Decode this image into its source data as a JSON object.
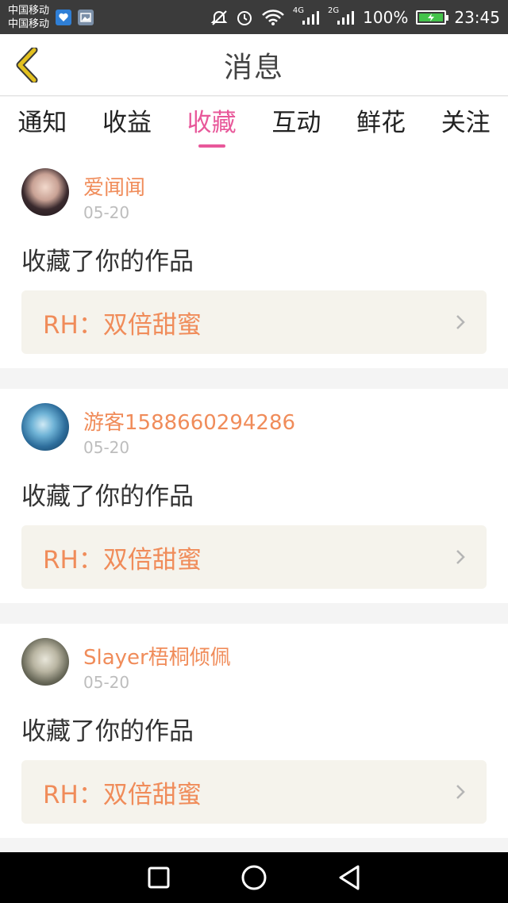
{
  "status_bar": {
    "carrier_1": "中国移动",
    "carrier_2": "中国移动",
    "battery_percent": "100%",
    "time": "23:45",
    "net_4g": "4G",
    "net_2g": "2G",
    "icons": [
      "mute-icon",
      "alarm-icon",
      "wifi-icon",
      "signal-icon",
      "battery-icon"
    ]
  },
  "header": {
    "title": "消息",
    "back_icon": "chevron-left-icon"
  },
  "tabs": [
    {
      "label": "通知",
      "active": false
    },
    {
      "label": "收益",
      "active": false
    },
    {
      "label": "收藏",
      "active": true
    },
    {
      "label": "互动",
      "active": false
    },
    {
      "label": "鲜花",
      "active": false
    },
    {
      "label": "关注",
      "active": false
    }
  ],
  "messages": [
    {
      "username": "爱闻闻",
      "date": "05-20",
      "action": "收藏了你的作品",
      "work_title": "RH：双倍甜蜜"
    },
    {
      "username": "游客1588660294286",
      "date": "05-20",
      "action": "收藏了你的作品",
      "work_title": "RH：双倍甜蜜"
    },
    {
      "username": "Slayer梧桐倾佩",
      "date": "05-20",
      "action": "收藏了你的作品",
      "work_title": "RH：双倍甜蜜"
    }
  ],
  "colors": {
    "accent_pink": "#e8589a",
    "username_orange": "#f08c5a",
    "back_yellow": "#e3c11f"
  }
}
